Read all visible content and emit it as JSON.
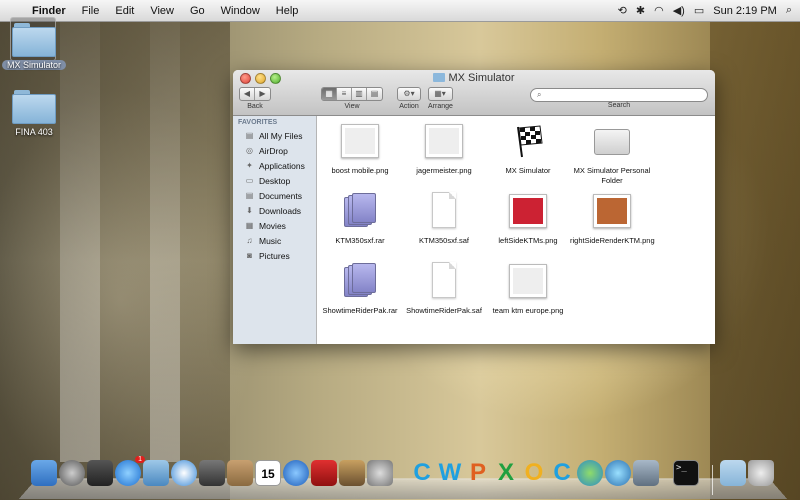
{
  "menubar": {
    "app_name": "Finder",
    "items": [
      "File",
      "Edit",
      "View",
      "Go",
      "Window",
      "Help"
    ],
    "clock": "Sun 2:19 PM"
  },
  "desktop": {
    "icons": [
      {
        "label": "MX Simulator",
        "selected": true
      },
      {
        "label": "FINA 403",
        "selected": false
      }
    ]
  },
  "window": {
    "title": "MX Simulator",
    "toolbar": {
      "back_label": "Back",
      "view_label": "View",
      "action_label": "Action",
      "arrange_label": "Arrange",
      "search_label": "Search",
      "search_placeholder": ""
    },
    "sidebar": {
      "heading": "FAVORITES",
      "items": [
        {
          "label": "All My Files",
          "icon": "all-files-icon"
        },
        {
          "label": "AirDrop",
          "icon": "airdrop-icon"
        },
        {
          "label": "Applications",
          "icon": "applications-icon"
        },
        {
          "label": "Desktop",
          "icon": "desktop-icon"
        },
        {
          "label": "Documents",
          "icon": "documents-icon"
        },
        {
          "label": "Downloads",
          "icon": "downloads-icon"
        },
        {
          "label": "Movies",
          "icon": "movies-icon"
        },
        {
          "label": "Music",
          "icon": "music-icon"
        },
        {
          "label": "Pictures",
          "icon": "pictures-icon"
        }
      ]
    },
    "files": [
      {
        "name": "boost mobile.png",
        "kind": "image"
      },
      {
        "name": "jagermeister.png",
        "kind": "image"
      },
      {
        "name": "MX Simulator",
        "kind": "app"
      },
      {
        "name": "MX Simulator Personal Folder",
        "kind": "drive"
      },
      {
        "name": "KTM350sxf.rar",
        "kind": "rar"
      },
      {
        "name": "KTM350sxf.saf",
        "kind": "doc"
      },
      {
        "name": "leftSideKTMs.png",
        "kind": "image"
      },
      {
        "name": "rightSideRenderKTM.png",
        "kind": "image"
      },
      {
        "name": "ShowtimeRiderPak.rar",
        "kind": "rar"
      },
      {
        "name": "ShowtimeRiderPak.saf",
        "kind": "doc"
      },
      {
        "name": "team ktm europe.png",
        "kind": "image"
      }
    ]
  },
  "dock": {
    "apps": [
      "finder",
      "launchpad",
      "dashboard",
      "app-store",
      "mail",
      "safari",
      "facetime",
      "contacts",
      "calendar",
      "itunes",
      "photo-booth",
      "iphoto",
      "system-preferences",
      "word",
      "powerpoint",
      "excel",
      "outlook",
      "communicator",
      "messenger",
      "chrome",
      "remote-desktop",
      "terminal",
      "downloads-stack",
      "trash"
    ],
    "calendar_day": "15",
    "app_store_badge": "1"
  }
}
